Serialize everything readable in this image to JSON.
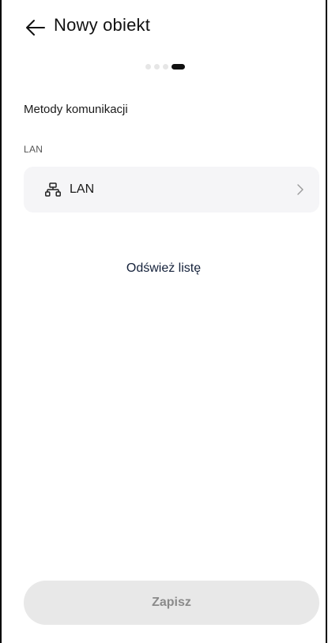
{
  "header": {
    "title": "Nowy obiekt",
    "back_icon": "arrow-left-icon"
  },
  "stepper": {
    "total_steps": 4,
    "current_step": 4
  },
  "content": {
    "section_title": "Metody komunikacji",
    "groups": [
      {
        "label": "LAN",
        "items": [
          {
            "label": "LAN",
            "icon": "network-icon",
            "trailing_icon": "chevron-right-icon"
          }
        ]
      }
    ],
    "refresh_label": "Odśwież listę"
  },
  "footer": {
    "save_label": "Zapisz",
    "save_enabled": false
  },
  "colors": {
    "background": "#ffffff",
    "list_item_bg": "#f5f5f7",
    "button_disabled_bg": "#e8e8e8",
    "button_disabled_text": "#8a8a8a",
    "link_text": "#14213a",
    "step_active": "#111111",
    "step_inactive": "#e6e6e6"
  }
}
